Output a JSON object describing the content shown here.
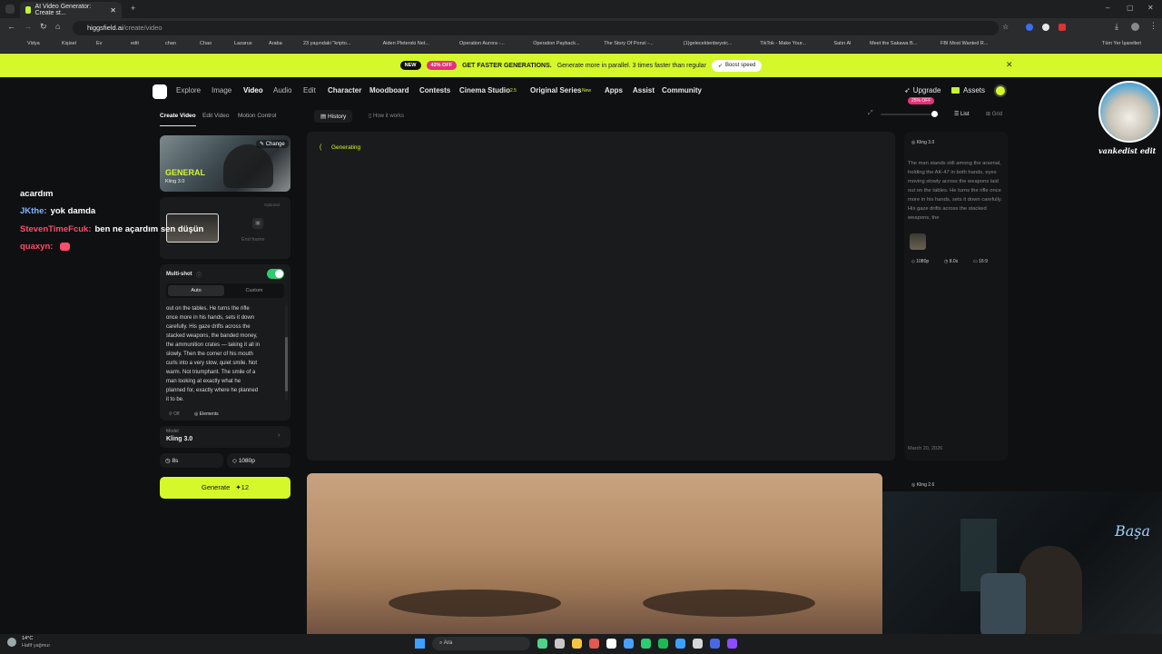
{
  "browser": {
    "tab_title": "AI Video Generator: Create st...",
    "url_prefix": "higgsfield.ai",
    "url_path": "/create/video",
    "bookmarks": [
      "Vidya",
      "Kişisel",
      "Ev",
      "edit",
      "chan",
      "Chao",
      "Lazarus",
      "Araba",
      "23 yaşındaki \"kripto...",
      "Aiden Pleterski Net...",
      "Operation Aurora -...",
      "Operation Payback...",
      "The Story Of Ponzi -...",
      "(1)gelecektenbeyoic...",
      "TikTok - Make Your...",
      "Satın Al",
      "Meet the Sakawa B...",
      "FBI Most Wanted R...",
      "Tüm Yer İşaretleri"
    ]
  },
  "promo": {
    "new_badge": "NEW",
    "discount_badge": "42% OFF",
    "headline": "GET FASTER GENERATIONS.",
    "body": "Generate more in parallel. 3 times faster than regular",
    "cta": "Boost speed"
  },
  "nav": {
    "items": [
      "Explore",
      "Image",
      "Video",
      "Audio",
      "Edit",
      "Character",
      "Moodboard",
      "Contests",
      "Cinema Studio",
      "Original Series",
      "Apps",
      "Assist",
      "Community"
    ],
    "cinema_badge": "2.5",
    "series_badge": "New",
    "upgrade": "Upgrade",
    "upgrade_badge": "25% OFF",
    "assets": "Assets"
  },
  "sidebar": {
    "tabs": [
      "Create Video",
      "Edit Video",
      "Motion Control"
    ],
    "preset_title": "GENERAL",
    "preset_model": "Kling 3.0",
    "change_label": "Change",
    "optional_label": "Optional",
    "end_frame_label": "End frame",
    "multishot_label": "Multi-shot",
    "mode_auto": "Auto",
    "mode_custom": "Custom",
    "prompt_lines": [
      "out on the tables. He turns the rifle",
      "once more in his hands, sets it down",
      "carefully. His gaze drifts across the",
      "stacked weapons, the banded money,",
      "the ammunition crates — taking it all in",
      "slowly. Then the corner of his mouth",
      "curls into a very slow, quiet smile. Not",
      "warm. Not triumphant. The smile of a",
      "man looking at exactly what he",
      "planned for, exactly where he planned",
      "it to be."
    ],
    "toggle_off": "Off",
    "elements": "Elements",
    "model_label": "Model",
    "model_value": "Kling 3.0",
    "duration": "8s",
    "resolution": "1080p",
    "generate_label": "Generate",
    "generate_cost": "12"
  },
  "main": {
    "history_tab": "History",
    "how_it_works": "How it works",
    "generating": "Generating",
    "list_label": "List",
    "grid_label": "Grid"
  },
  "right": {
    "model1": "Kling 3.0",
    "description": "The man stands still among the arsenal, holding the AK-47 in both hands, eyes moving slowly across the weapons laid out on the tables. He turns the rifle once more in his hands, sets it down carefully. His gaze drifts across the stacked weapons, the",
    "res": "1080p",
    "dur": "8.0s",
    "ratio": "16:9",
    "date": "March 20, 2026",
    "model2": "Kling 2.6"
  },
  "chat": [
    {
      "user": "",
      "text": "acardım",
      "color": "#ffffff"
    },
    {
      "user": "JKthe:",
      "text": "yok damda",
      "color": "#7fb6ff"
    },
    {
      "user": "StevenTimeFcuk:",
      "text": "ben ne açardım sen düşün",
      "color": "#ff4d6d"
    },
    {
      "user": "quaxyn:",
      "text": "",
      "color": "#ff4d6d"
    }
  ],
  "overlay": {
    "avatar_name": "vankedist edit",
    "neon_text": "Başa"
  },
  "taskbar": {
    "weather_temp": "14°C",
    "weather_desc": "Hafif yağmur",
    "search": "Ara"
  },
  "colors": {
    "accent": "#d4f82a",
    "toggle": "#2ecc71",
    "upgrade_badge": "#e6307a"
  }
}
